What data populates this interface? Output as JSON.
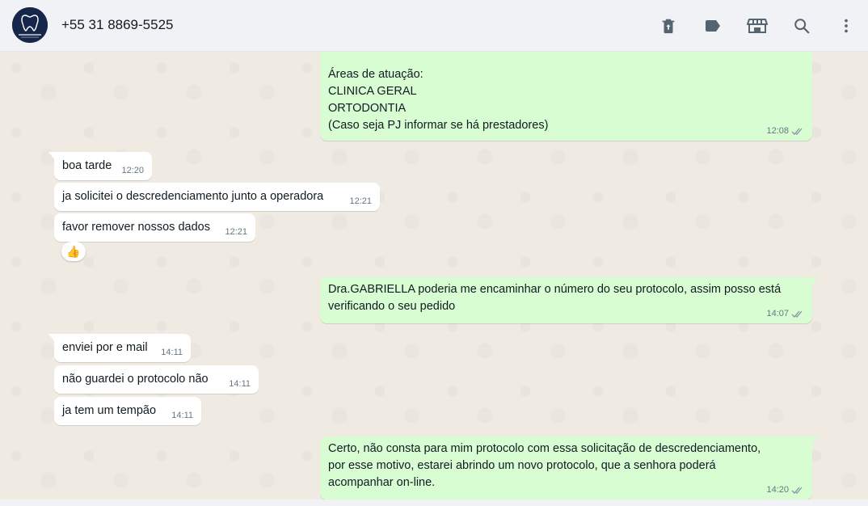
{
  "header": {
    "contact_name": "+55 31 8869-5525",
    "icons": [
      "delete-icon",
      "label-icon",
      "catalog-icon",
      "search-icon",
      "menu-icon"
    ]
  },
  "messages": [
    {
      "dir": "out",
      "text": "Áreas de atuação:\nCLINICA GERAL\nORTODONTIA\n(Caso seja PJ informar se há prestadores)",
      "time": "12:08",
      "status": "read"
    },
    {
      "dir": "in",
      "text": "boa tarde",
      "time": "12:20"
    },
    {
      "dir": "in",
      "text": "ja solicitei o descredenciamento junto a operadora",
      "time": "12:21"
    },
    {
      "dir": "in",
      "text": "favor remover nossos dados",
      "time": "12:21",
      "reaction": "👍"
    },
    {
      "dir": "out",
      "text": "Dra.GABRIELLA poderia me encaminhar o número do seu protocolo, assim posso está\nverificando o seu pedido",
      "time": "14:07",
      "status": "read"
    },
    {
      "dir": "in",
      "text": "enviei por e mail",
      "time": "14:11"
    },
    {
      "dir": "in",
      "text": "não guardei o protocolo não",
      "time": "14:11"
    },
    {
      "dir": "in",
      "text": "ja tem um tempão",
      "time": "14:11"
    },
    {
      "dir": "out",
      "text": "Certo, não consta para mim protocolo com essa solicitação de descredenciamento,\npor esse motivo, estarei abrindo um novo protocolo, que a senhora poderá\nacompanhar on-line.",
      "time": "14:20",
      "status": "read"
    }
  ],
  "colors": {
    "outgoing_bubble": "#d9fdd3",
    "incoming_bubble": "#ffffff",
    "chat_background": "#efeae2",
    "header_background": "#f0f2f5",
    "read_ticks": "#8696a0"
  }
}
